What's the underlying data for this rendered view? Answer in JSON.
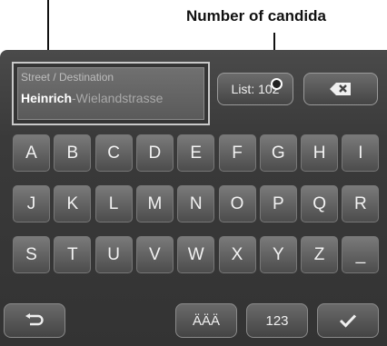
{
  "annotations": {
    "candidates_label": "Number of candida"
  },
  "destination": {
    "label": "Street / Destination",
    "typed": "Heinrich",
    "completion": "-Wielandstrasse"
  },
  "list_button": {
    "label": "List: 102"
  },
  "backspace_button": {
    "icon": "backspace-icon"
  },
  "keyboard": {
    "rows": [
      [
        "A",
        "B",
        "C",
        "D",
        "E",
        "F",
        "G",
        "H",
        "I"
      ],
      [
        "J",
        "K",
        "L",
        "M",
        "N",
        "O",
        "P",
        "Q",
        "R"
      ],
      [
        "S",
        "T",
        "U",
        "V",
        "W",
        "X",
        "Y",
        "Z",
        "_"
      ]
    ]
  },
  "bottom_bar": {
    "enter_icon": "return-icon",
    "umlaut_label": "ÄÄÄ",
    "numbers_label": "123",
    "confirm_icon": "checkmark-icon"
  }
}
